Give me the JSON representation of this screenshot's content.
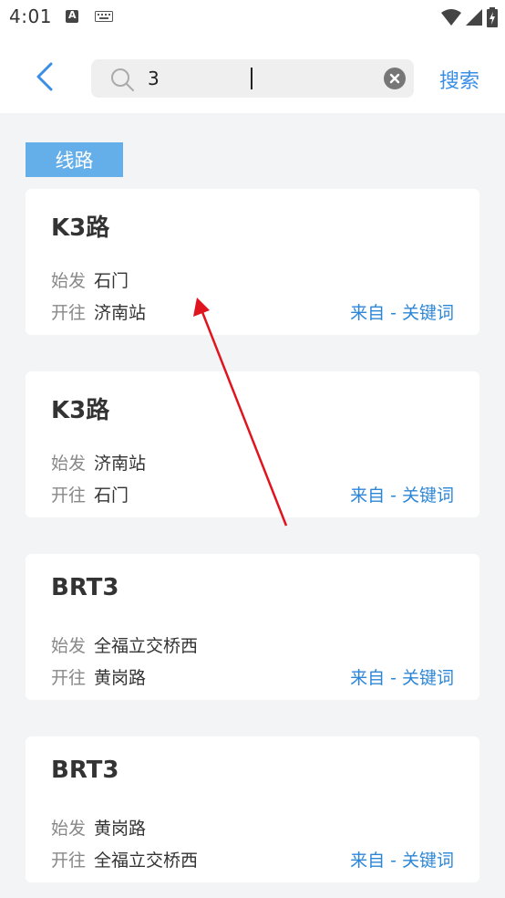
{
  "status_bar": {
    "time": "4:01",
    "icons": [
      "a-notification-icon",
      "keyboard-icon",
      "wifi-icon",
      "signal-icon",
      "battery-icon"
    ]
  },
  "header": {
    "back_icon": "back-arrow-icon",
    "search_query": "3",
    "search_button_label": "搜索"
  },
  "section_label": "线路",
  "routes": [
    {
      "name": "K3路",
      "start_label": "始发",
      "start": "石门",
      "end_label": "开往",
      "end": "济南站",
      "source": "来自 - 关键词"
    },
    {
      "name": "K3路",
      "start_label": "始发",
      "start": "济南站",
      "end_label": "开往",
      "end": "石门",
      "source": "来自 - 关键词"
    },
    {
      "name": "BRT3",
      "start_label": "始发",
      "start": "全福立交桥西",
      "end_label": "开往",
      "end": "黄岗路",
      "source": "来自 - 关键词"
    },
    {
      "name": "BRT3",
      "start_label": "始发",
      "start": "黄岗路",
      "end_label": "开往",
      "end": "全福立交桥西",
      "source": "来自 - 关键词"
    }
  ],
  "colors": {
    "accent": "#3a8ee6",
    "tag_bg": "#64aeea",
    "link": "#2c86d8",
    "annotation_arrow": "#e0141e"
  }
}
